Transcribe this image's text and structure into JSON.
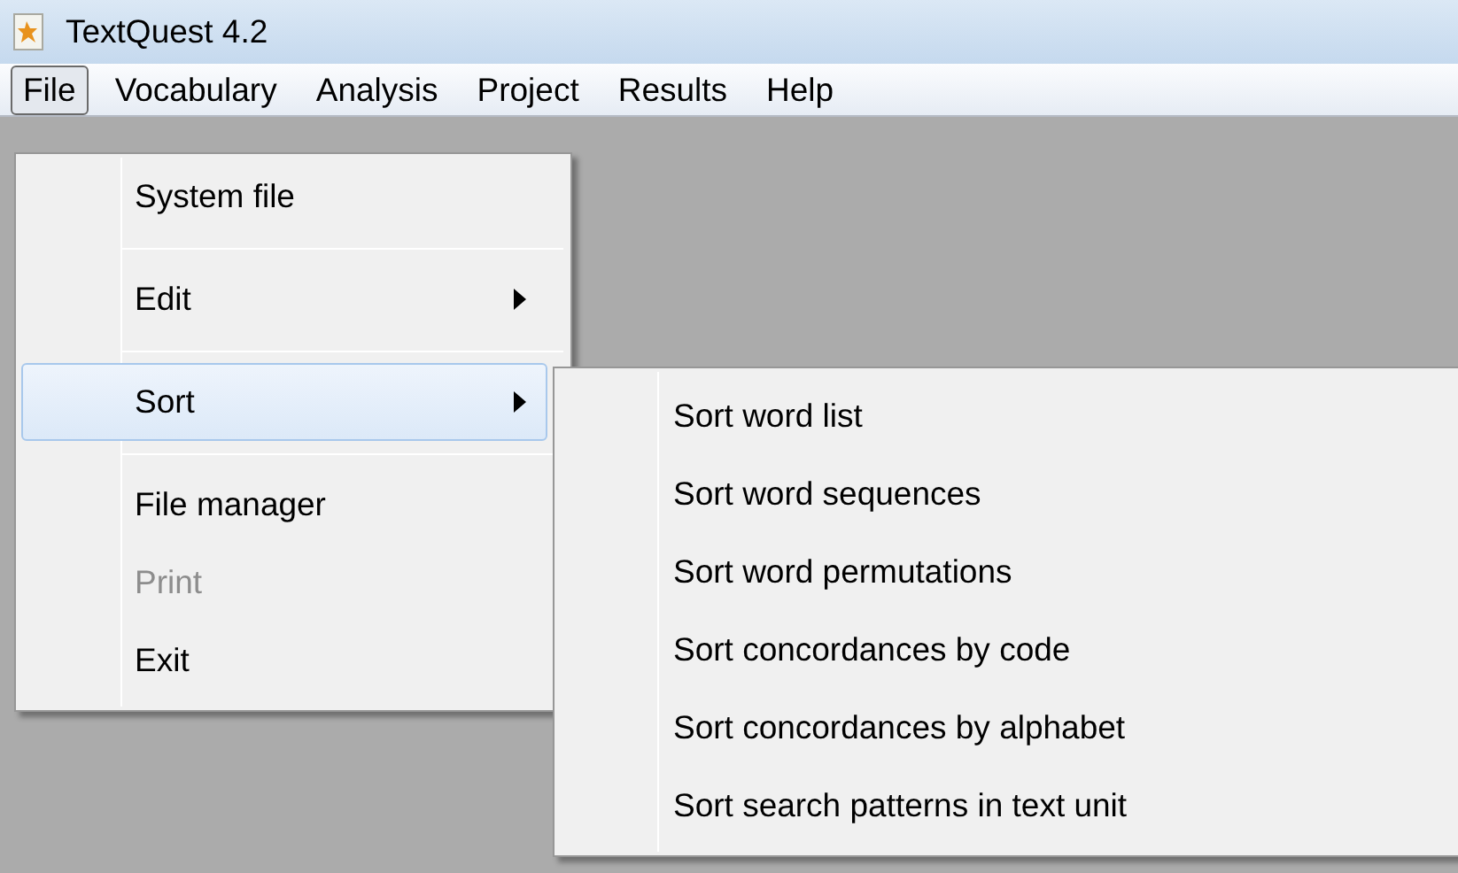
{
  "window": {
    "title": "TextQuest 4.2"
  },
  "menu_bar": [
    {
      "label": "File",
      "selected": true
    },
    {
      "label": "Vocabulary",
      "selected": false
    },
    {
      "label": "Analysis",
      "selected": false
    },
    {
      "label": "Project",
      "selected": false
    },
    {
      "label": "Results",
      "selected": false
    },
    {
      "label": "Help",
      "selected": false
    }
  ],
  "file_menu": [
    {
      "kind": "item",
      "label": "System file",
      "has_submenu": false,
      "selected": false,
      "disabled": false
    },
    {
      "kind": "separator"
    },
    {
      "kind": "item",
      "label": "Edit",
      "has_submenu": true,
      "selected": false,
      "disabled": false
    },
    {
      "kind": "separator"
    },
    {
      "kind": "item",
      "label": "Sort",
      "has_submenu": true,
      "selected": true,
      "disabled": false
    },
    {
      "kind": "separator"
    },
    {
      "kind": "item",
      "label": "File manager",
      "has_submenu": false,
      "selected": false,
      "disabled": false
    },
    {
      "kind": "item",
      "label": "Print",
      "has_submenu": false,
      "selected": false,
      "disabled": true
    },
    {
      "kind": "item",
      "label": "Exit",
      "has_submenu": false,
      "selected": false,
      "disabled": false
    }
  ],
  "sort_submenu": [
    {
      "label": "Sort word list"
    },
    {
      "label": "Sort word sequences"
    },
    {
      "label": "Sort word permutations"
    },
    {
      "label": "Sort concordances by code"
    },
    {
      "label": "Sort concordances by alphabet"
    },
    {
      "label": "Sort search patterns in text unit"
    }
  ]
}
